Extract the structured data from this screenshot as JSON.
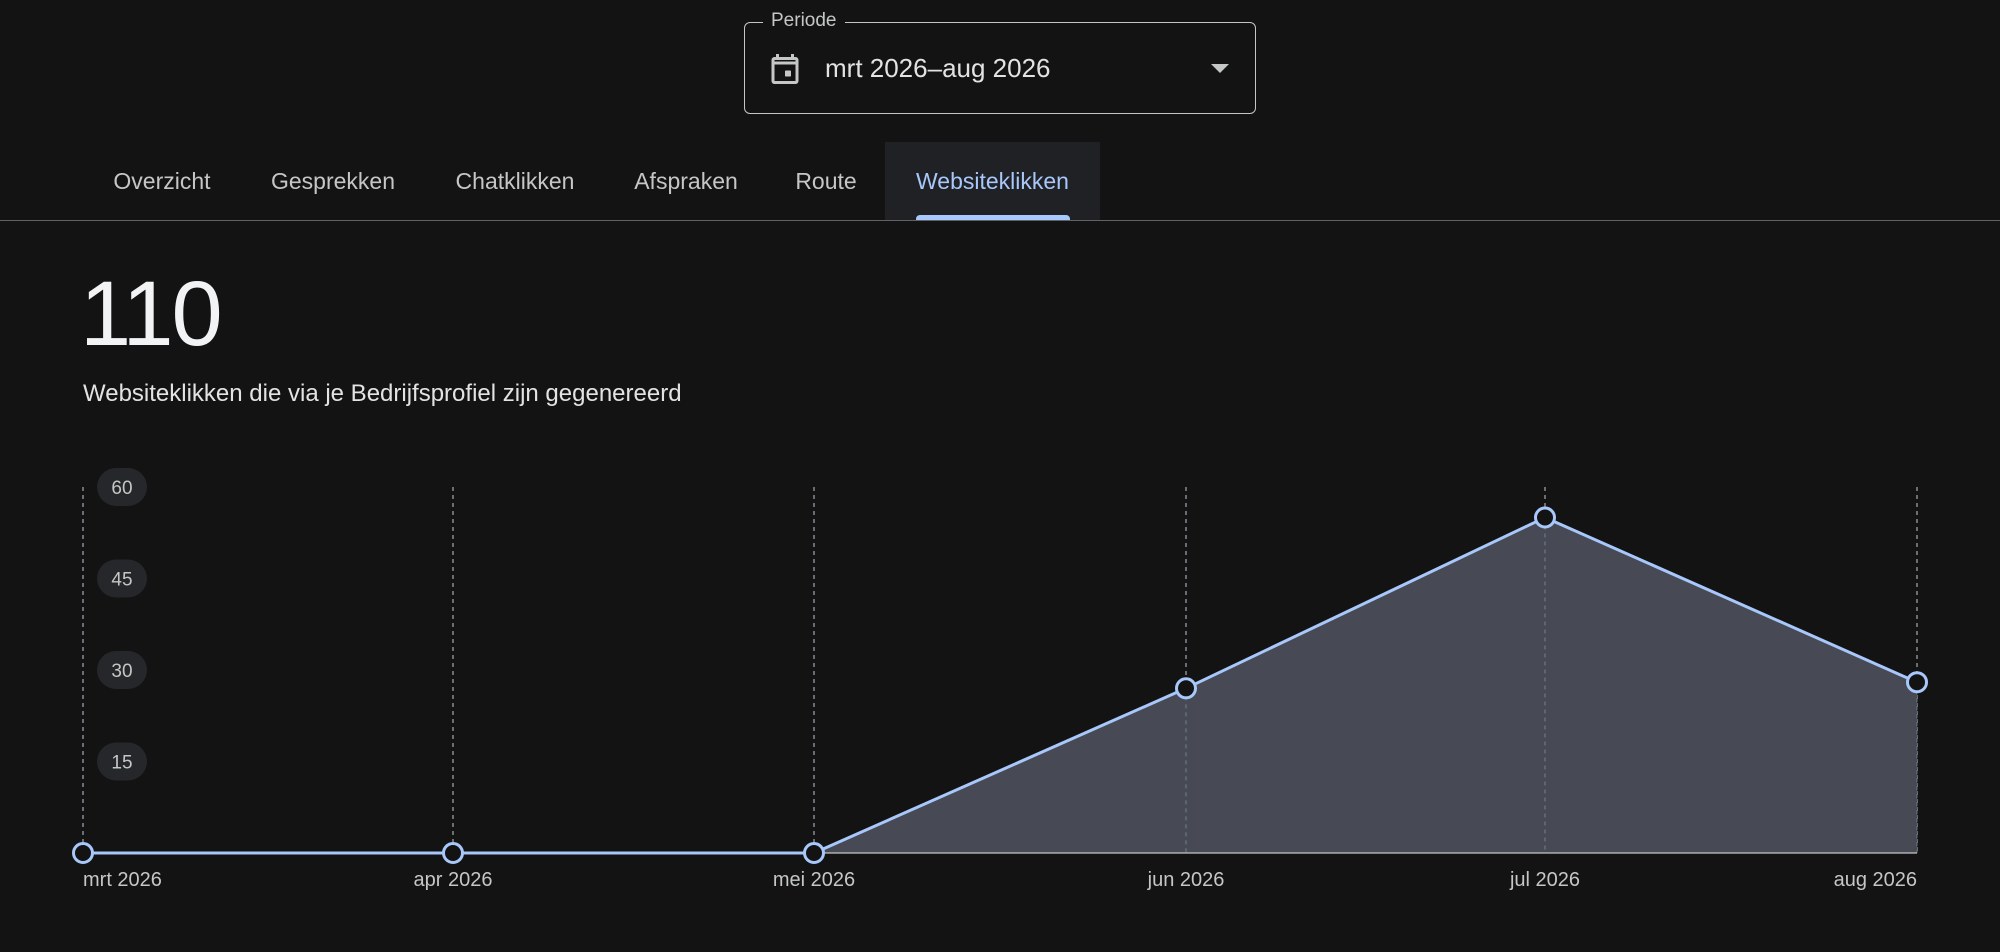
{
  "period": {
    "label": "Periode",
    "value": "mrt 2026–aug 2026"
  },
  "tabs": [
    {
      "label": "Overzicht",
      "active": false
    },
    {
      "label": "Gesprekken",
      "active": false
    },
    {
      "label": "Chatklikken",
      "active": false
    },
    {
      "label": "Afspraken",
      "active": false
    },
    {
      "label": "Route",
      "active": false
    },
    {
      "label": "Websiteklikken",
      "active": true
    }
  ],
  "metric": {
    "value": "110",
    "description": "Websiteklikken die via je Bedrijfsprofiel zijn gegenereerd"
  },
  "colors": {
    "accent": "#a8c7fa",
    "area_fill": "#474a54",
    "background": "#131314"
  },
  "chart_data": {
    "type": "area",
    "categories": [
      "mrt 2026",
      "apr 2026",
      "mei 2026",
      "jun 2026",
      "jul 2026",
      "aug 2026"
    ],
    "values": [
      0,
      0,
      0,
      27,
      55,
      28
    ],
    "yticks": [
      15,
      30,
      45,
      60
    ],
    "ylim": [
      0,
      60
    ],
    "grid": "vertical-dashed"
  }
}
